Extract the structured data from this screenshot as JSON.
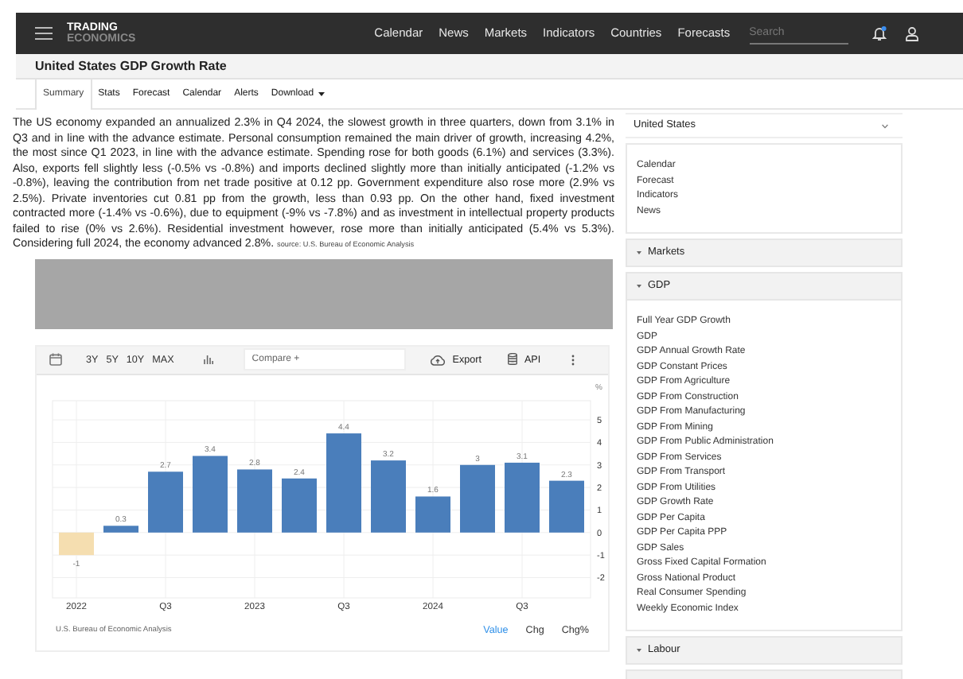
{
  "nav": {
    "logo_top": "TRADING",
    "logo_bottom": "ECONOMICS",
    "links": [
      "Calendar",
      "News",
      "Markets",
      "Indicators",
      "Countries",
      "Forecasts"
    ],
    "search": {
      "placeholder": "Search"
    },
    "notifications": {
      "unread": true
    }
  },
  "title": "United States GDP Growth Rate",
  "tabs": [
    {
      "label": "Summary",
      "selected": true,
      "dropdown": false
    },
    {
      "label": "Stats",
      "selected": false,
      "dropdown": false
    },
    {
      "label": "Forecast",
      "selected": false,
      "dropdown": false
    },
    {
      "label": "Calendar",
      "selected": false,
      "dropdown": false
    },
    {
      "label": "Alerts",
      "selected": false,
      "dropdown": false
    },
    {
      "label": "Download",
      "selected": false,
      "dropdown": true
    }
  ],
  "summary": {
    "text": "The US economy expanded an annualized 2.3% in Q4 2024, the slowest growth in three quarters, down from 3.1% in Q3 and in line with the advance estimate. Personal consumption remained the main driver of growth, increasing 4.2%, the most since Q1 2023, in line with the advance estimate. Spending rose for both goods (6.1%) and services (3.3%). Also, exports fell slightly less (-0.5% vs -0.8%) and imports declined slightly more than initially anticipated (-1.2% vs -0.8%), leaving the contribution from net trade positive at 0.12 pp. Government expenditure also rose more (2.9% vs 2.5%). Private inventories cut 0.81 pp from the growth, less than 0.93 pp. On the other hand, fixed investment contracted more (-1.4% vs -0.6%), due to equipment (-9% vs -7.8%) and as investment in intellectual property products failed to rise (0% vs 2.6%). Residential investment however, rose more than initially anticipated (5.4% vs 5.3%). Considering full 2024, the economy advanced 2.8%.",
    "source": "source: U.S. Bureau of Economic Analysis"
  },
  "chart": {
    "ranges": [
      "3Y",
      "5Y",
      "10Y",
      "MAX"
    ],
    "compare": {
      "placeholder": "Compare +"
    },
    "export": "Export",
    "api": "API",
    "unit": "%",
    "source": "U.S. Bureau of Economic Analysis",
    "modes": [
      {
        "label": "Value",
        "selected": true
      },
      {
        "label": "Chg",
        "selected": false
      },
      {
        "label": "Chg%",
        "selected": false
      }
    ],
    "chart_data": {
      "type": "bar",
      "categories": [
        "2022",
        null,
        "Q3",
        null,
        "2023",
        null,
        "Q3",
        null,
        "2024",
        null,
        "Q3",
        null
      ],
      "series": [
        {
          "color": "#4a7ebb",
          "values": [
            null,
            0.3,
            2.7,
            3.4,
            2.8,
            2.4,
            4.4,
            3.2,
            1.6,
            3,
            3.1,
            2.3
          ]
        },
        {
          "color": "#f5deb0",
          "values": [
            -1,
            null,
            null,
            null,
            null,
            null,
            null,
            null,
            null,
            null,
            null,
            null
          ]
        }
      ],
      "stacked": true,
      "grid": true,
      "yticks": [
        -2,
        -1,
        0,
        1,
        2,
        3,
        4,
        5
      ],
      "ylim": [
        -2.9,
        5.85
      ],
      "data_labels": true
    }
  },
  "sidebar": {
    "country": "United States",
    "links": [
      "Calendar",
      "Forecast",
      "Indicators",
      "News"
    ],
    "sections": [
      {
        "title": "Markets"
      },
      {
        "title": "GDP",
        "items": [
          "Full Year GDP Growth",
          "GDP",
          "GDP Annual Growth Rate",
          "GDP Constant Prices",
          "GDP From Agriculture",
          "GDP From Construction",
          "GDP From Manufacturing",
          "GDP From Mining",
          "GDP From Public Administration",
          "GDP From Services",
          "GDP From Transport",
          "GDP From Utilities",
          "GDP Growth Rate",
          "GDP Per Capita",
          "GDP Per Capita PPP",
          "GDP Sales",
          "Gross Fixed Capital Formation",
          "Gross National Product",
          "Real Consumer Spending",
          "Weekly Economic Index"
        ]
      },
      {
        "title": "Labour"
      }
    ]
  }
}
